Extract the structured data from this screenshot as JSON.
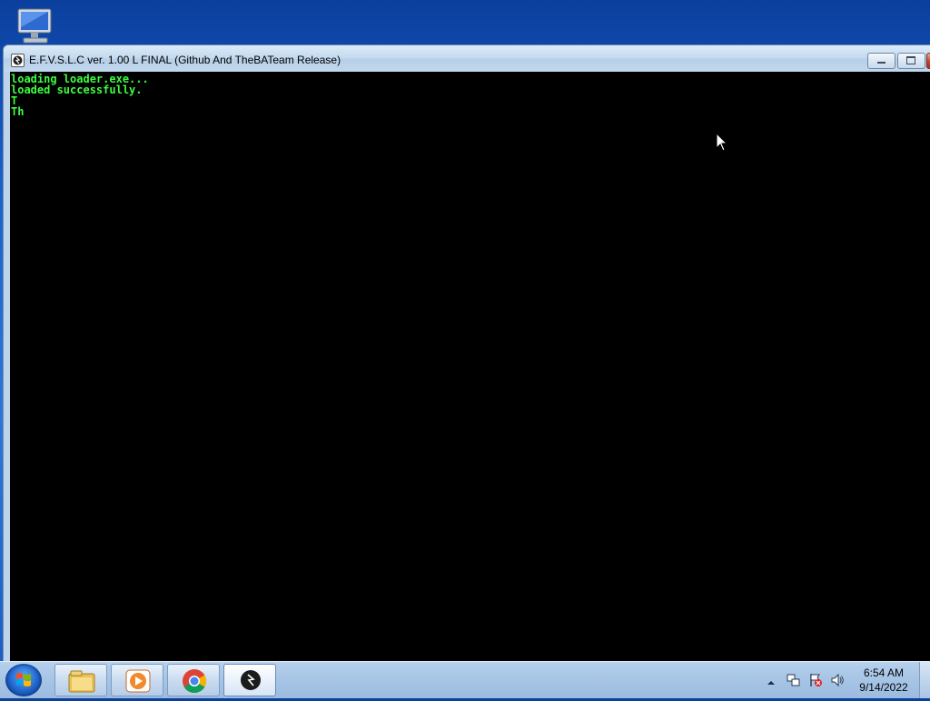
{
  "desktop": {
    "icon_name": "computer-icon"
  },
  "window": {
    "title": "E.F.V.S.L.C ver. 1.00 L FINAL (Github And TheBATeam Release)",
    "buttons": {
      "minimize": "minimize-icon",
      "maximize": "maximize-icon",
      "close": "close-icon"
    },
    "console_lines": [
      "loading loader.exe...",
      "loaded successfully.",
      "T",
      "Th"
    ],
    "text_color": "#3cff3c",
    "background_color": "#000000"
  },
  "taskbar": {
    "start": "windows-start-icon",
    "items": [
      {
        "name": "file-explorer",
        "icon": "folder-icon"
      },
      {
        "name": "media-player",
        "icon": "media-player-icon"
      },
      {
        "name": "chrome",
        "icon": "chrome-icon"
      },
      {
        "name": "console-app",
        "icon": "app-icon",
        "active": true
      }
    ],
    "tray": {
      "icons": [
        "show-hidden-icons-arrow",
        "network-icon",
        "action-center-flag-icon",
        "volume-icon"
      ],
      "time": "6:54 AM",
      "date": "9/14/2022"
    }
  }
}
